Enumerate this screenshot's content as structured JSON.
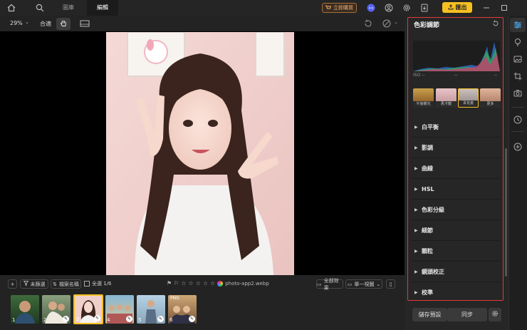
{
  "topbar": {
    "tabs": [
      "圖庫",
      "編輯"
    ],
    "active_tab": "編輯",
    "buy_label": "立即購買",
    "export_label": "匯出",
    "icons": [
      "home-icon",
      "search-icon",
      "discord-icon",
      "user-icon",
      "gear-icon",
      "update-icon",
      "minimize-icon",
      "maximize-icon"
    ]
  },
  "toolbar": {
    "zoom": "29%",
    "fit_label": "合適"
  },
  "image": {
    "filename": "photo-app2.webp",
    "rating_stars": 5
  },
  "filmstrip": {
    "filter_label": "未篩選",
    "sort_label": "檔案名稱",
    "select_all_label": "全選 1/6",
    "all_effects_label": "全部效果",
    "view_label": "單一視圖",
    "thumbnails": [
      {
        "num": "1",
        "badge": ""
      },
      {
        "num": "2",
        "badge": ""
      },
      {
        "num": "3",
        "badge": "",
        "selected": true
      },
      {
        "num": "4",
        "badge": ""
      },
      {
        "num": "5",
        "badge": ""
      },
      {
        "num": "6",
        "badge": "PNG"
      }
    ]
  },
  "panel": {
    "title": "色彩調節",
    "histogram_labels": [
      "ISO --",
      "--",
      "--"
    ],
    "presets": [
      "午後暖光",
      "馬卡龍",
      "青花瓷",
      "更多"
    ],
    "active_preset": "青花瓷",
    "sections": [
      "白平衡",
      "影調",
      "曲線",
      "HSL",
      "色彩分級",
      "細節",
      "顆粒",
      "鏡頭校正",
      "校準"
    ],
    "save_preset_label": "儲存預設",
    "sync_label": "同步"
  },
  "colors": {
    "accent": "#f7c021",
    "buy": "#f2b071",
    "outline": "#e23b3b",
    "selected_thumb": "#f7c021"
  }
}
